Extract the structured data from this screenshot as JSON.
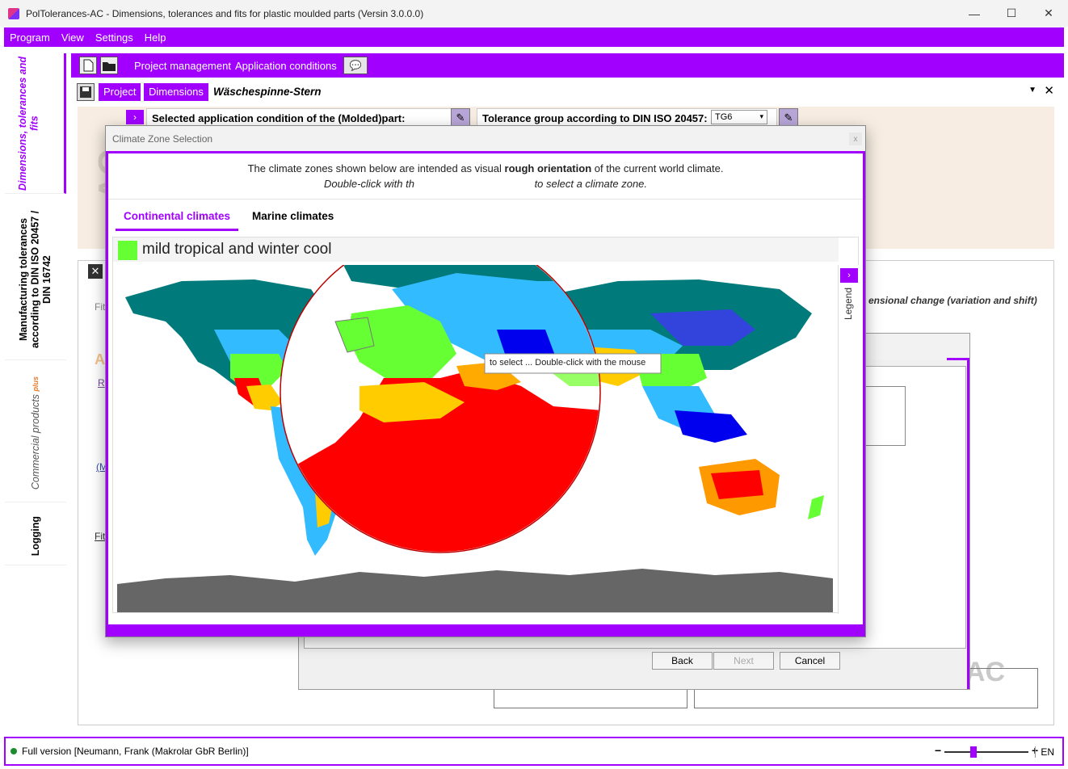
{
  "window": {
    "title": "PolTolerances-AC - Dimensions, tolerances and fits for plastic moulded parts (Versin 3.0.0.0)",
    "min": "—",
    "max": "☐",
    "close": "✕"
  },
  "menu": [
    "Program",
    "View",
    "Settings",
    "Help"
  ],
  "sidebar": {
    "items": [
      {
        "label": "Dimensions, tolerances and fits"
      },
      {
        "label": "Manufacturing tolerances according to DIN ISO 20457 / DIN 16742"
      },
      {
        "label": "Commercial products",
        "sup": "plus"
      },
      {
        "label": "Logging"
      }
    ]
  },
  "toolbar": {
    "project_management": "Project management",
    "application_conditions": "Application conditions",
    "help_icon": "💬"
  },
  "tabs": {
    "project": "Project",
    "dimensions": "Dimensions",
    "project_name": "Wäschespinne-Stern",
    "dropdown": "▼",
    "close": "✕"
  },
  "conditions": {
    "selected_condition": "Selected application condition of the (Molded)part:",
    "tolerance_group": "Tolerance group according to DIN ISO 20457:",
    "tg_value": "TG6",
    "watermark": "AC"
  },
  "background_fragments": {
    "fit": "Fit",
    "a": "A",
    "r": "R",
    "m": "(M",
    "fit2": "Fit",
    "dim_change": "ensional change (variation and shift)",
    "ac": "AC"
  },
  "wizard": {
    "back": "Back",
    "next": "Next",
    "cancel": "Cancel"
  },
  "dialog": {
    "title": "Climate Zone Selection",
    "close": "x",
    "intro_pre": "The climate zones shown below are intended as visual ",
    "intro_bold": "rough orientation",
    "intro_post": " of the current world climate.",
    "intro2_a": "Double-click with th",
    "intro2_b": " to select a climate zone.",
    "tabs": [
      "Continental climates",
      "Marine climates"
    ],
    "zone_label": "mild tropical and winter cool",
    "zone_color": "#66ff33",
    "legend": "Legend",
    "legend_arrow": "›",
    "tooltip": "to select ... Double-click with the mouse"
  },
  "status": {
    "text": "Full version [Neumann, Frank (Makrolar GbR Berlin)]",
    "zoom_level": 0.35,
    "lang": "EN"
  },
  "colors": {
    "accent": "#a100ff",
    "desert": "#ff0000",
    "tropical": "#0000ee",
    "temperate": "#66ff33",
    "cold": "#33bbff",
    "polar": "#007a7a",
    "ice": "#666666"
  }
}
